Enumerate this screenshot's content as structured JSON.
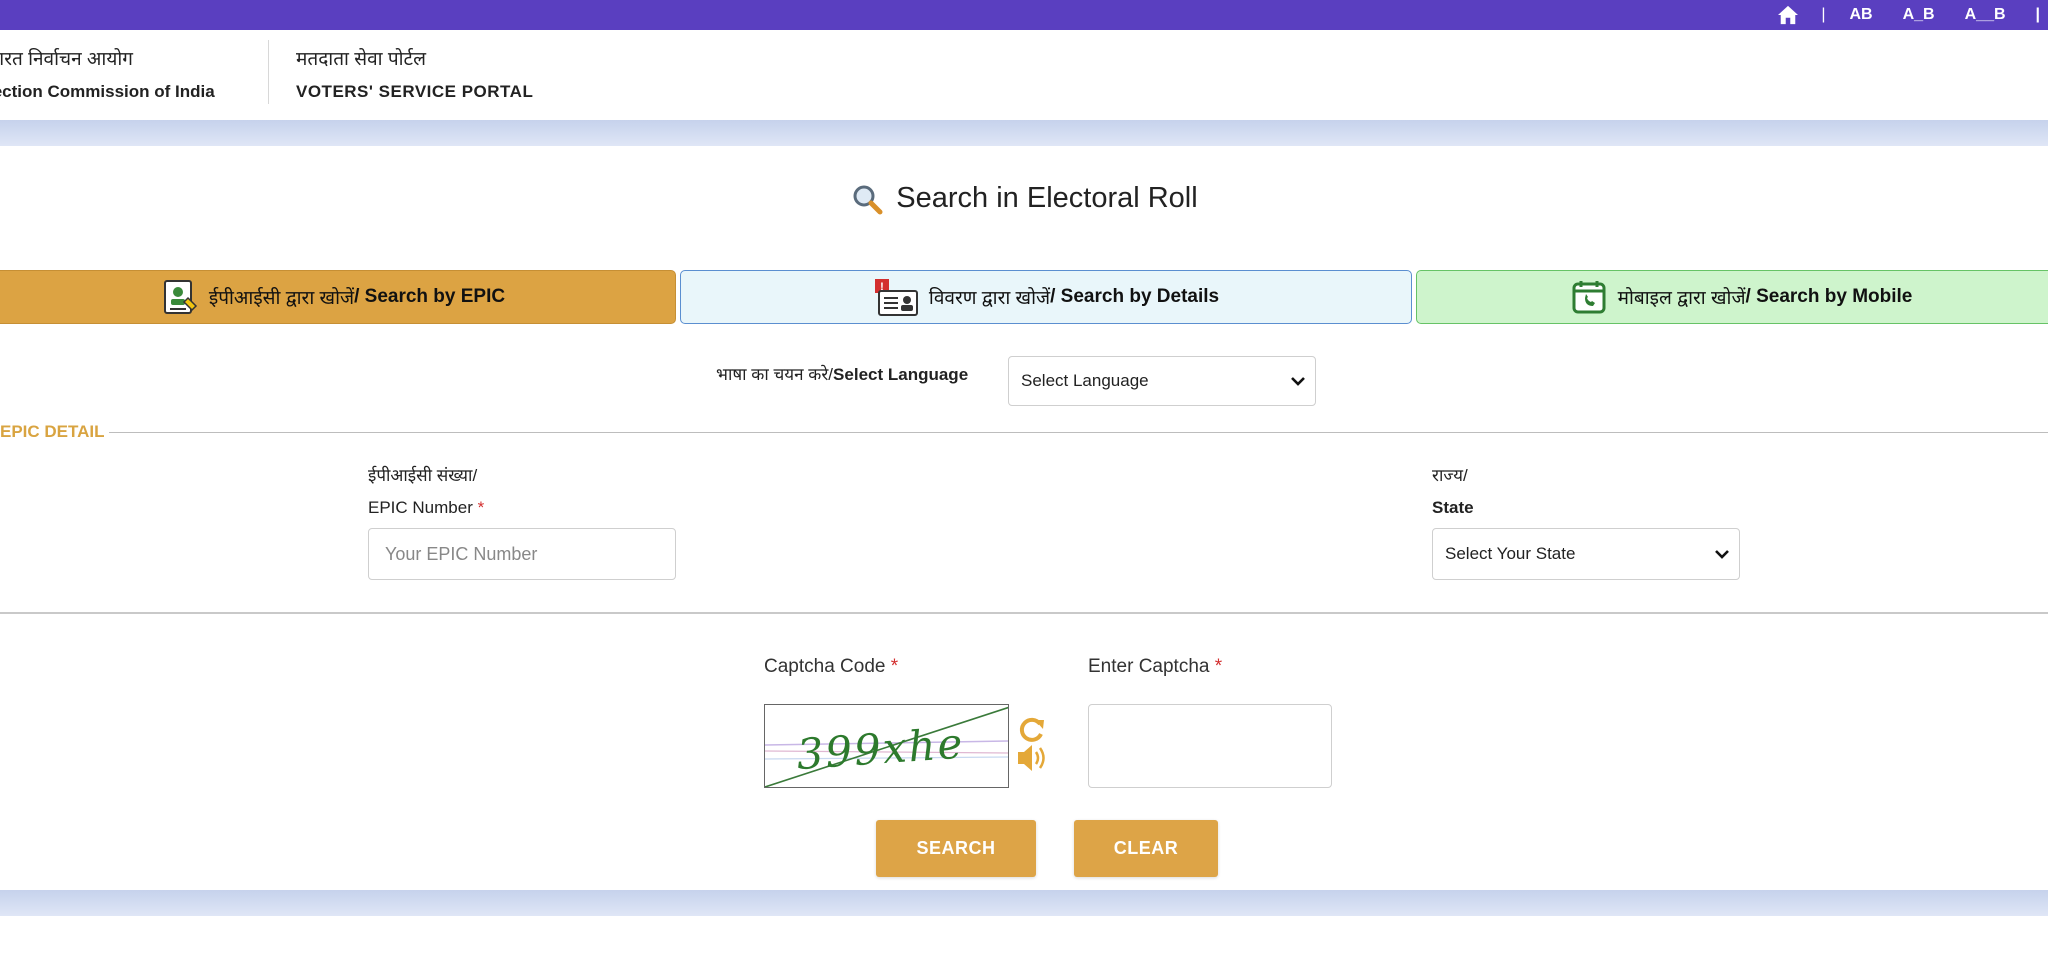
{
  "topbar": {
    "separator": "|",
    "text_sizes": [
      "AB",
      "A_B",
      "A__B"
    ],
    "trailing_separator": "|"
  },
  "header": {
    "org_hindi": "ारत निर्वाचन आयोग",
    "org_english": "lection Commission of India",
    "portal_hindi": "मतदाता सेवा पोर्टल",
    "portal_english": "VOTERS' SERVICE PORTAL"
  },
  "page": {
    "title": "Search in Electoral Roll"
  },
  "tabs": [
    {
      "hindi": "ईपीआईसी द्वारा खोजें",
      "english": " / Search by EPIC",
      "icon": "id-card-icon",
      "color": "#dca343"
    },
    {
      "hindi": "विवरण द्वारा खोजें",
      "english": "/ Search by Details",
      "icon": "details-form-icon",
      "color": "#e9f6fa"
    },
    {
      "hindi": "मोबाइल द्वारा खोजें",
      "english": " / Search by Mobile",
      "icon": "mobile-calendar-icon",
      "color": "#cef4cc"
    }
  ],
  "language": {
    "label_hindi": "भाषा का चयन करे/",
    "label_english": "Select Language",
    "selected": "Select Language"
  },
  "epic_section": {
    "legend": "EPIC DETAIL",
    "epic_label_hindi": "ईपीआईसी संख्या/",
    "epic_label_english": "EPIC Number",
    "required_mark": "*",
    "epic_placeholder": "Your EPIC Number",
    "state_label_hindi": "राज्य/",
    "state_label_english": "State",
    "state_selected": "Select Your State"
  },
  "captcha": {
    "code_label": "Captcha Code",
    "enter_label": "Enter Captcha",
    "required_mark": "*",
    "image_text": "399xhe"
  },
  "buttons": {
    "search": "SEARCH",
    "clear": "CLEAR"
  },
  "colors": {
    "topbar": "#5a3fc0",
    "accent_gold": "#dca343",
    "required": "#d32f2f"
  }
}
